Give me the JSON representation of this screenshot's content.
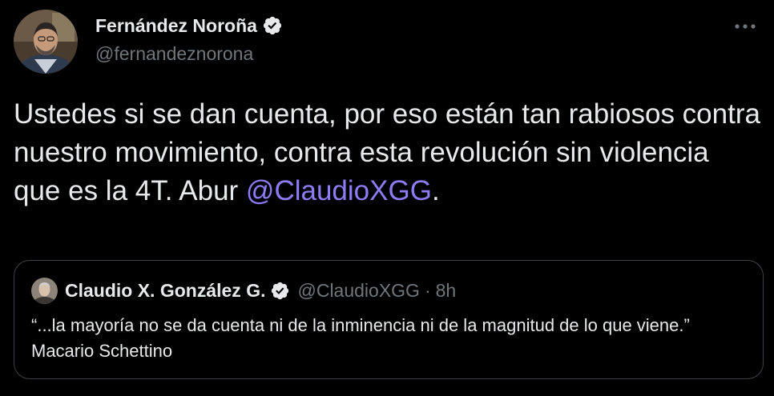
{
  "author": {
    "name": "Fernández Noroña",
    "handle": "@fernandeznorona",
    "verified": true,
    "avatar_icon": "profile-photo"
  },
  "menu": {
    "icon": "more-horizontal-icon"
  },
  "tweet": {
    "text": "Ustedes si se dan cuenta, por eso están tan rabiosos contra nuestro movimiento, contra esta revolución sin violencia que es la 4T. Abur ",
    "mention": "@ClaudioXGG",
    "trailing": "."
  },
  "quoted_tweet": {
    "name": "Claudio X. González G.",
    "handle": "@ClaudioXGG",
    "separator": "·",
    "time": "8h",
    "verified": true,
    "text": "“...la mayoría no se da cuenta ni de la inminencia ni de la magnitud de lo que viene.” Macario Schettino"
  },
  "colors": {
    "background": "#000000",
    "text": "#e7e9ea",
    "secondary": "#71767b",
    "mention": "#8e7cf7",
    "border": "#3d4145",
    "verified_badge": "#e7e9ea"
  }
}
